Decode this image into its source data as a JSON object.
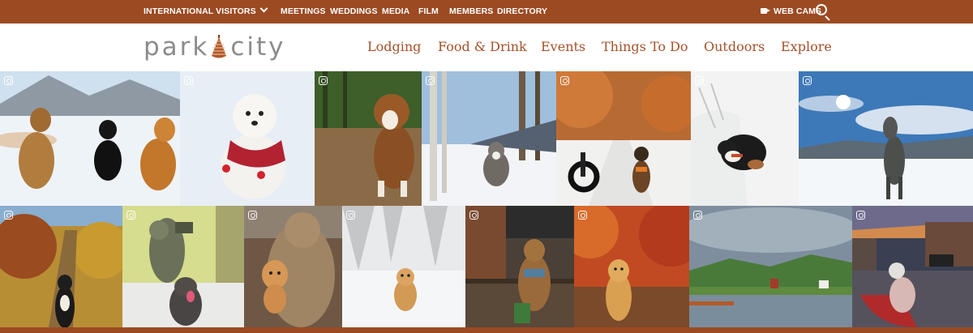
{
  "top_bar": {
    "international": "INTERNATIONAL VISITORS",
    "links": [
      "MEETINGS",
      "WEDDINGS",
      "MEDIA",
      "FILM",
      "MEMBERS",
      "DIRECTORY"
    ],
    "webcams": "WEB CAMS"
  },
  "header": {
    "logo_left": "park",
    "logo_right": "city",
    "nav": [
      "Lodging",
      "Food & Drink",
      "Events",
      "Things To Do",
      "Outdoors",
      "Explore"
    ]
  },
  "colors": {
    "brand_brown": "#9c4a22",
    "nav_text": "#a5512a",
    "logo_gray": "#8c8c8c"
  },
  "icons": [
    "chevron-down-icon",
    "camera-icon",
    "search-icon",
    "pinecone-logo-icon",
    "instagram-icon"
  ]
}
